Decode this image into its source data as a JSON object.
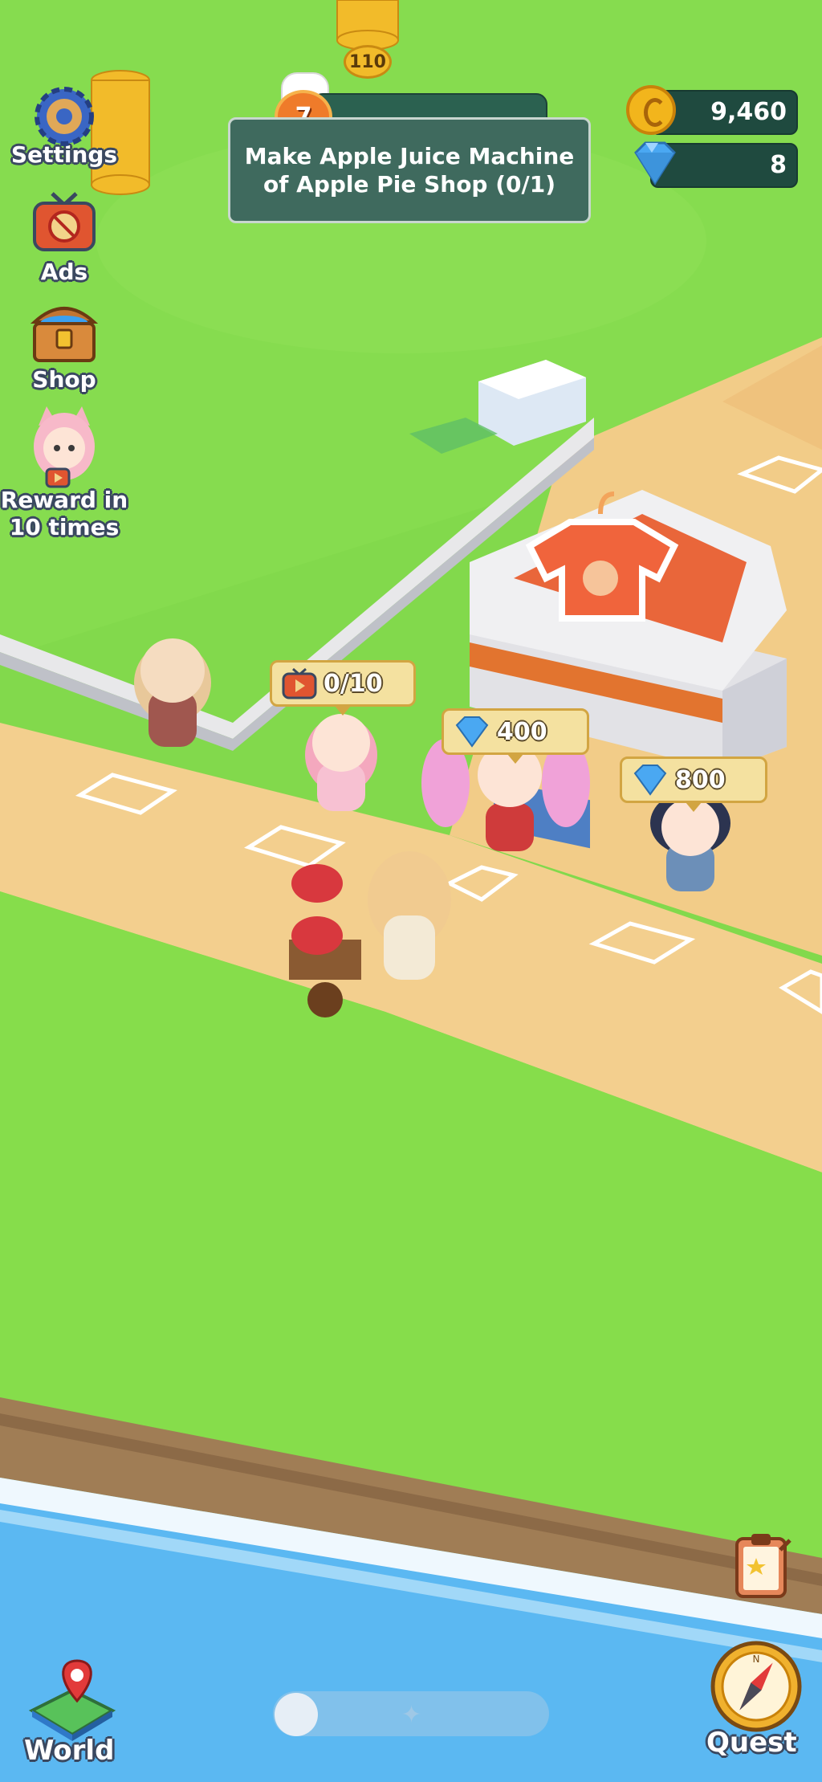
{
  "hud": {
    "level": "7",
    "quest_text_line1": "Make Apple Juice Machine",
    "quest_text_line2": "of Apple Pie Shop (0/1)",
    "top_counter": "110",
    "coins": "9,460",
    "gems": "8"
  },
  "side_menu": {
    "settings": "Settings",
    "ads": "Ads",
    "shop": "Shop",
    "reward_line1": "Reward in",
    "reward_line2": "10 times"
  },
  "bubbles": {
    "ad_progress": "0/10",
    "gem_price_1": "400",
    "gem_price_2": "800"
  },
  "bottom": {
    "world": "World",
    "quest": "Quest"
  },
  "colors": {
    "grass": "#7ed84a",
    "sand": "#f3d191",
    "water": "#5bb8f2",
    "coin": "#f2b51c",
    "gem": "#4aa8f2",
    "panel": "#3f6a5e"
  },
  "icons": {
    "settings": "gear-donut-icon",
    "ads": "tv-icon",
    "shop": "treasure-chest-icon",
    "reward": "character-ad-icon",
    "world": "map-pin-icon",
    "quest": "compass-icon",
    "clipboard": "quest-clipboard-icon"
  }
}
